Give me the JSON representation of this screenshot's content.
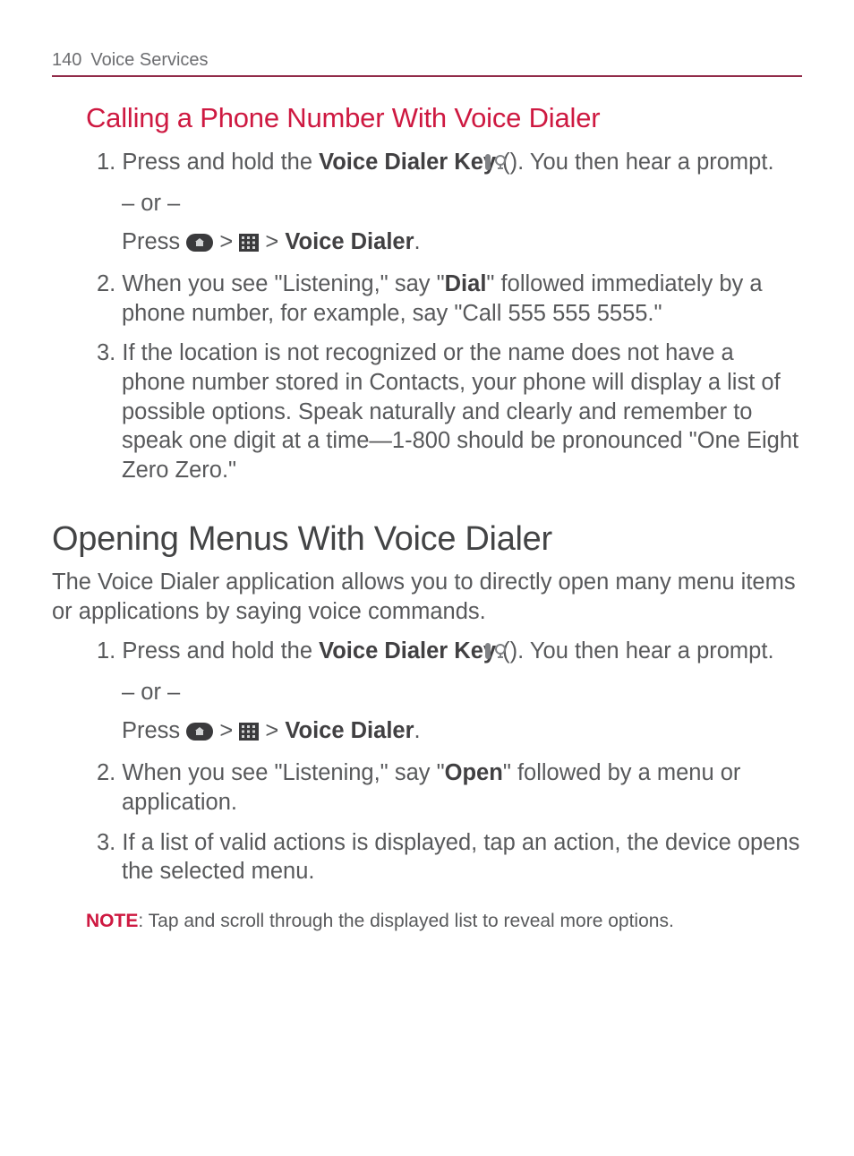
{
  "header": {
    "page_number": "140",
    "section": "Voice Services"
  },
  "section1": {
    "title": "Calling a Phone Number With Voice Dialer",
    "step1_pre": "Press and hold the ",
    "step1_bold": "Voice Dialer Key",
    "step1_post": " (",
    "step1_close": "). You then hear a prompt.",
    "or": "– or –",
    "press_pre": "Press ",
    "press_gt1": " > ",
    "press_gt2": " > ",
    "voice_dialer": "Voice Dialer",
    "period": ".",
    "step2_pre": "When you see \"Listening,\" say \"",
    "step2_bold": "Dial",
    "step2_post": "\" followed immediately by a phone number, for example, say \"Call 555 555 5555.\"",
    "step3": "If the location is not recognized or the name does not have a phone number stored in Contacts, your phone will display a list of possible options. Speak naturally and clearly and remember to speak one digit at a time—1-800 should be pronounced \"One Eight Zero Zero.\""
  },
  "section2": {
    "title": "Opening Menus With Voice Dialer",
    "intro": "The Voice Dialer application allows you to directly open many menu items or applications by saying voice commands.",
    "step1_pre": "Press and hold the ",
    "step1_bold": "Voice Dialer Key",
    "step1_post": " (",
    "step1_close": "). You then hear a prompt.",
    "or": "– or –",
    "press_pre": "Press ",
    "press_gt1": " > ",
    "press_gt2": " > ",
    "voice_dialer": "Voice Dialer",
    "period": ".",
    "step2_pre": "When you see \"Listening,\" say \"",
    "step2_bold": "Open",
    "step2_post": "\" followed by a menu or application.",
    "step3": "If a list of valid actions is displayed, tap an action, the device opens the selected menu."
  },
  "note": {
    "label": "NOTE",
    "text": ": Tap and scroll through the displayed list to reveal more options."
  },
  "numbers": {
    "n1": "1.",
    "n2": "2.",
    "n3": "3."
  }
}
